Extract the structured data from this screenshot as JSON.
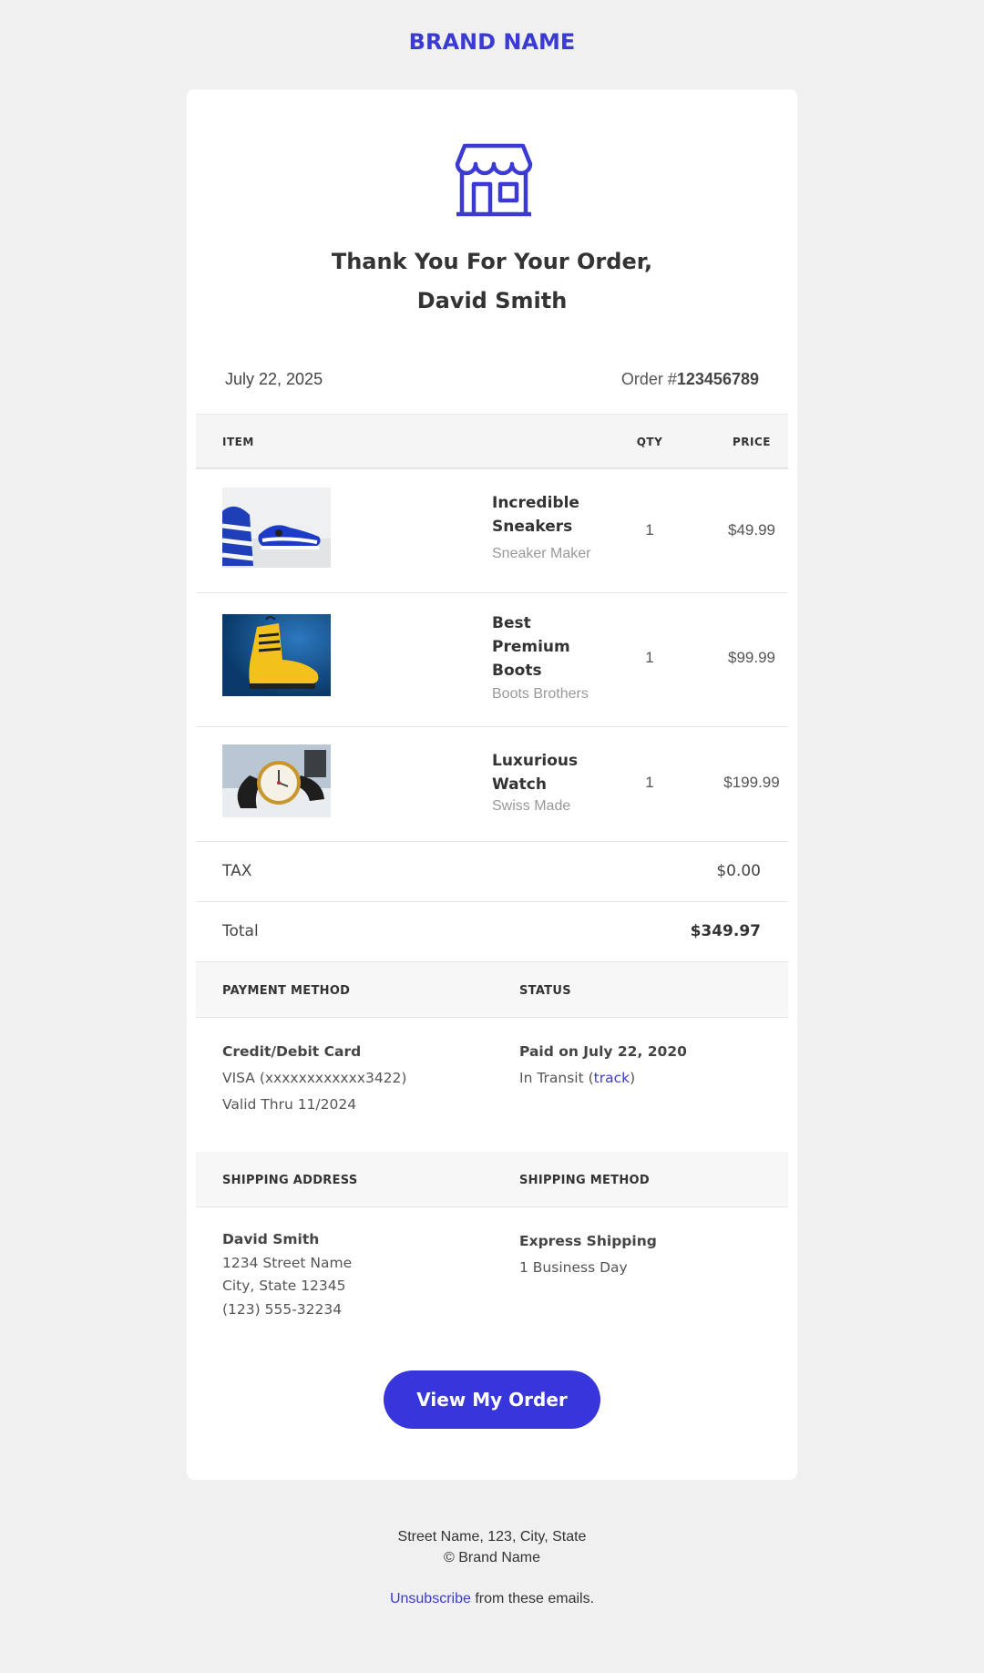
{
  "brand": {
    "name": "BRAND NAME",
    "color": "#3b3bd4"
  },
  "header": {
    "icon": "store-icon",
    "greeting_line1": "Thank You For Your Order,",
    "greeting_line2": "David Smith"
  },
  "order": {
    "date": "July 22, 2025",
    "number_prefix": "Order #",
    "number": "123456789"
  },
  "table": {
    "headers": {
      "item": "ITEM",
      "qty": "QTY",
      "price": "PRICE"
    },
    "items": [
      {
        "name": "Incredible Sneakers",
        "maker": "Sneaker Maker",
        "qty": "1",
        "price": "$49.99",
        "image": "sneakers-photo"
      },
      {
        "name": "Best Premium Boots",
        "maker": "Boots Brothers",
        "qty": "1",
        "price": "$99.99",
        "image": "boots-photo"
      },
      {
        "name": "Luxurious Watch",
        "maker": "Swiss Made",
        "qty": "1",
        "price": "$199.99",
        "image": "watch-photo"
      }
    ],
    "tax_label": "TAX",
    "tax_value": "$0.00",
    "total_label": "Total",
    "total_value": "$349.97"
  },
  "payment": {
    "heading": "PAYMENT METHOD",
    "method": "Credit/Debit Card",
    "card": "VISA (xxxxxxxxxxxx3422)",
    "valid": "Valid Thru 11/2024"
  },
  "status": {
    "heading": "STATUS",
    "paid": "Paid on July 22, 2020",
    "transit_prefix": "In Transit (",
    "track_link": "track",
    "transit_suffix": ")"
  },
  "shipping_address": {
    "heading": "SHIPPING ADDRESS",
    "name": "David Smith",
    "street": "1234 Street Name",
    "city": "City, State 12345",
    "phone": "(123) 555-32234"
  },
  "shipping_method": {
    "heading": "SHIPPING METHOD",
    "method": "Express Shipping",
    "duration": "1 Business Day"
  },
  "cta": {
    "label": "View My Order",
    "color": "#3636dc"
  },
  "footer": {
    "address": "Street Name, 123, City, State",
    "copyright": "© Brand Name",
    "unsubscribe_link": "Unsubscribe",
    "unsubscribe_suffix": " from these emails."
  }
}
